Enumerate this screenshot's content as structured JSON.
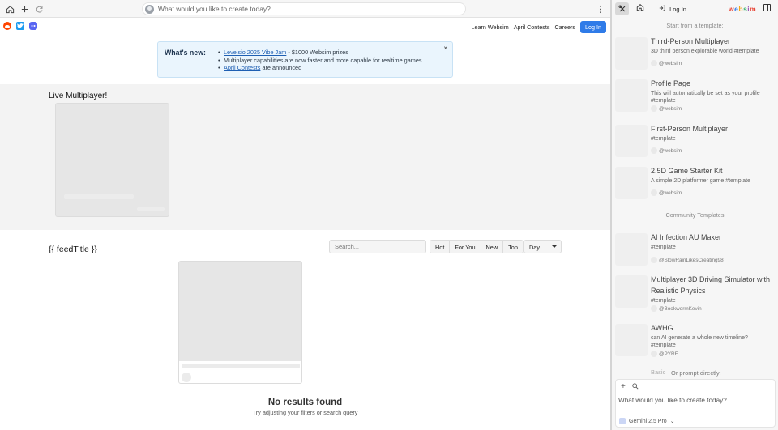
{
  "browser": {
    "address_placeholder": "What would you like to create today?",
    "icons": [
      "home-icon",
      "plus-icon",
      "refresh-icon",
      "kebab-menu-icon"
    ]
  },
  "nav": {
    "social": [
      "reddit-icon",
      "twitter-icon",
      "discord-icon"
    ],
    "links": [
      "Learn Websim",
      "April Contests",
      "Careers"
    ],
    "login_label": "Log In"
  },
  "whats_new": {
    "title": "What's new:",
    "items": [
      {
        "link": "Levelsio 2025 Vibe Jam",
        "text": " - $1000 Websim prizes"
      },
      {
        "link": "",
        "text": "Multiplayer capabilities are now faster and more capable for realtime games."
      },
      {
        "link": "April Contests",
        "text": " are announced"
      }
    ],
    "close": "×"
  },
  "live": {
    "title": "Live Multiplayer!"
  },
  "feed": {
    "title": "{{ feedTitle }}",
    "search_placeholder": "Search...",
    "filters": [
      "Hot",
      "For You",
      "New",
      "Top"
    ],
    "period": "Day",
    "empty_title": "No results found",
    "empty_subtitle": "Try adjusting your filters or search query"
  },
  "panel": {
    "login_label": "Log In",
    "logo_letters": [
      "w",
      "e",
      "b",
      "s",
      "i",
      "m"
    ],
    "start_heading": "Start from a template:",
    "templates": [
      {
        "title": "Third-Person Multiplayer",
        "desc": "3D third person explorable world #template",
        "author": "@websim"
      },
      {
        "title": "Profile Page",
        "desc": "This will automatically be set as your profile #template",
        "author": "@websim"
      },
      {
        "title": "First-Person Multiplayer",
        "desc": "#template",
        "author": "@websim"
      },
      {
        "title": "2.5D Game Starter Kit",
        "desc": "A simple 2D platformer game #template",
        "author": "@websim"
      }
    ],
    "community_heading": "Community Templates",
    "community": [
      {
        "title": "AI Infection AU Maker",
        "desc": "#template",
        "author": "@SlowRainLikesCreating98"
      },
      {
        "title": "Multiplayer 3D Driving Simulator with Realistic Physics",
        "desc": "#template",
        "author": "@BookwormKevin"
      },
      {
        "title": "AWHG",
        "desc": "can AI generate a whole new timeline? #template",
        "author": "@PYRE"
      }
    ],
    "fade_a": "Basic",
    "fade_b": "Or prompt directly:",
    "chat_placeholder": "What would you like to create today?",
    "model": "Gemini 2.5 Pro"
  }
}
